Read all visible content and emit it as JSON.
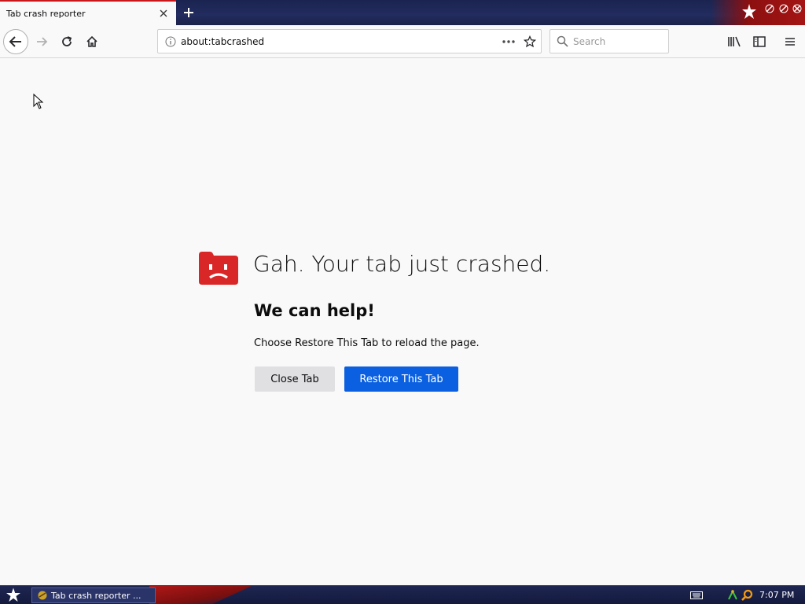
{
  "window": {
    "tab_title": "Tab crash reporter"
  },
  "navbar": {
    "url": "about:tabcrashed",
    "search_placeholder": "Search"
  },
  "content": {
    "title": "Gah. Your tab just crashed.",
    "help_heading": "We can help!",
    "description": "Choose Restore This Tab to reload the page.",
    "close_button": "Close Tab",
    "restore_button": "Restore This Tab"
  },
  "taskbar": {
    "task_label": "Tab crash reporter ...",
    "clock": "7:07 PM"
  },
  "colors": {
    "accent": "#0a60e0",
    "crash_icon": "#d92727",
    "tab_accent": "#c8181b"
  },
  "icons": [
    "close-icon",
    "plus-icon",
    "back-arrow-icon",
    "forward-arrow-icon",
    "reload-icon",
    "home-icon",
    "info-icon",
    "more-dots-icon",
    "bookmark-star-icon",
    "search-icon",
    "library-icon",
    "sidebar-icon",
    "menu-icon",
    "sad-tab-icon",
    "start-star-icon",
    "keyboard-icon",
    "network-icon"
  ]
}
